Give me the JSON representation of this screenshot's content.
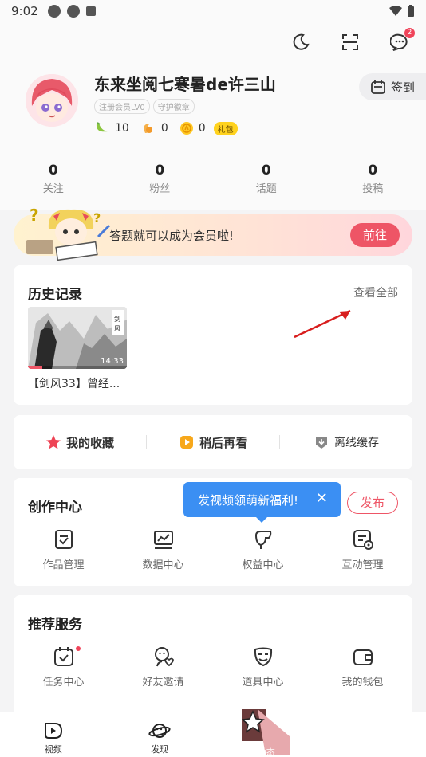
{
  "status_bar": {
    "time": "9:02"
  },
  "header": {
    "message_badge": "2"
  },
  "profile": {
    "username": "东来坐阅七寒暑de许三山",
    "tags": [
      "注册会员LV0",
      "守护徽章"
    ],
    "coins": [
      {
        "icon": "banana-icon",
        "value": "10"
      },
      {
        "icon": "candy-icon",
        "value": "0"
      },
      {
        "icon": "acoin-icon",
        "value": "0"
      }
    ],
    "gift_tag": "礼包",
    "checkin_label": "签到"
  },
  "stats": [
    {
      "value": "0",
      "label": "关注"
    },
    {
      "value": "0",
      "label": "粉丝"
    },
    {
      "value": "0",
      "label": "话题"
    },
    {
      "value": "0",
      "label": "投稿"
    }
  ],
  "promo": {
    "text": "答题就可以成为会员啦!",
    "button": "前往"
  },
  "history": {
    "title": "历史记录",
    "view_all": "查看全部",
    "items": [
      {
        "title": "【剑风33】曾经...",
        "duration": "14:33"
      }
    ]
  },
  "quick": {
    "favorites": "我的收藏",
    "watch_later": "稍后再看",
    "offline": "离线缓存"
  },
  "creation": {
    "title": "创作中心",
    "publish": "发布",
    "tooltip": "发视频领萌新福利!",
    "items": [
      "作品管理",
      "数据中心",
      "权益中心",
      "互动管理"
    ]
  },
  "services": {
    "title": "推荐服务",
    "items": [
      "任务中心",
      "好友邀请",
      "道具中心",
      "我的钱包"
    ]
  },
  "tabs": [
    "视频",
    "发现",
    "动态"
  ],
  "colors": {
    "accent": "#ee5566",
    "tooltip": "#3b8ff3",
    "badge": "#f0445a"
  }
}
